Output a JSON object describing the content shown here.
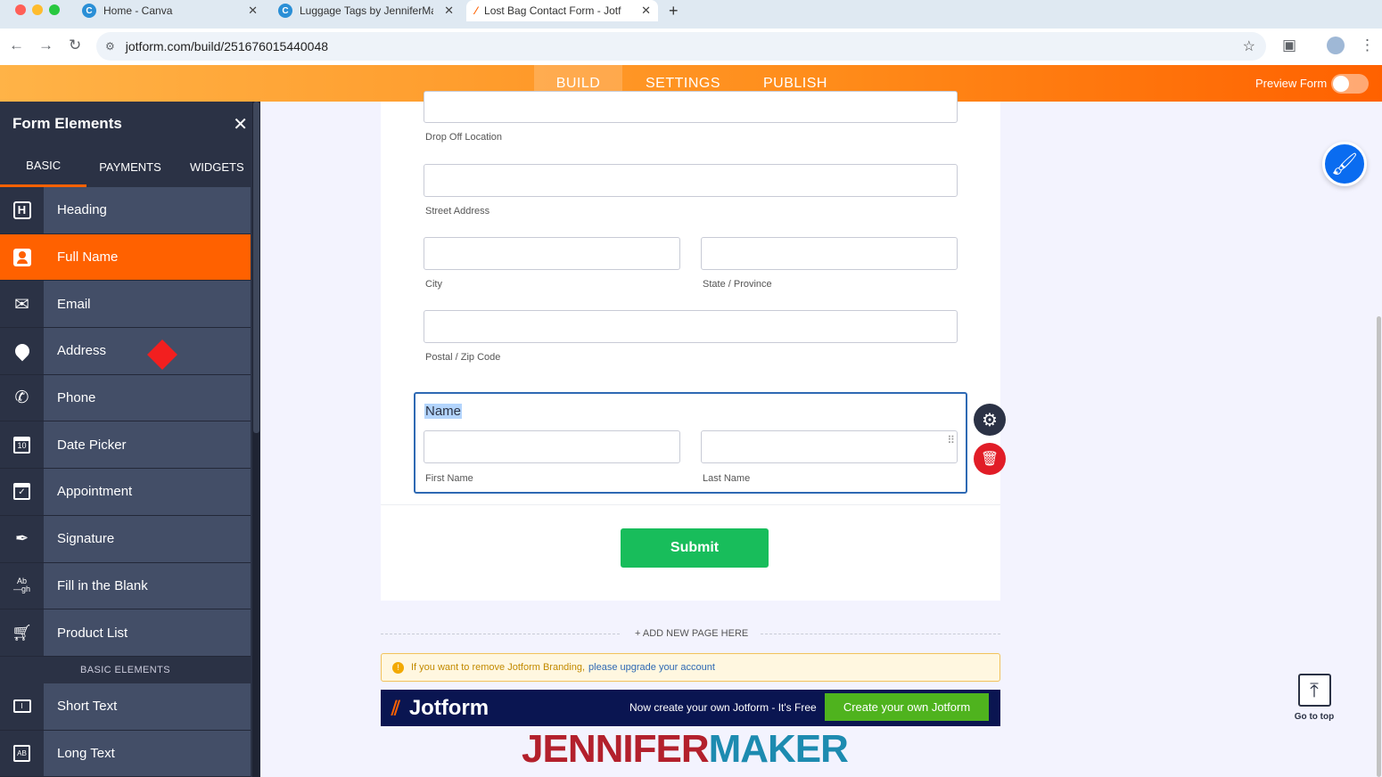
{
  "browser": {
    "tabs": [
      {
        "title": "Home - Canva",
        "icon": "canva-icon"
      },
      {
        "title": "Luggage Tags by JenniferMal",
        "icon": "canva-icon"
      },
      {
        "title": "Lost Bag Contact Form - Jotf",
        "icon": "jotform-icon"
      }
    ],
    "new_tab": "+",
    "url": "jotform.com/build/251676015440048"
  },
  "builder": {
    "nav": [
      "BUILD",
      "SETTINGS",
      "PUBLISH"
    ],
    "active_nav": "BUILD",
    "preview_label": "Preview Form"
  },
  "sidebar": {
    "title": "Form Elements",
    "tabs": [
      "BASIC",
      "PAYMENTS",
      "WIDGETS"
    ],
    "items": [
      {
        "label": "Heading",
        "icon": "heading-icon"
      },
      {
        "label": "Full Name",
        "icon": "person-icon"
      },
      {
        "label": "Email",
        "icon": "envelope-icon"
      },
      {
        "label": "Address",
        "icon": "map-pin-icon"
      },
      {
        "label": "Phone",
        "icon": "phone-icon"
      },
      {
        "label": "Date Picker",
        "icon": "calendar-icon"
      },
      {
        "label": "Appointment",
        "icon": "calendar-check-icon"
      },
      {
        "label": "Signature",
        "icon": "pen-icon"
      },
      {
        "label": "Fill in the Blank",
        "icon": "fill-blank-icon"
      },
      {
        "label": "Product List",
        "icon": "cart-icon"
      }
    ],
    "section_label": "BASIC ELEMENTS",
    "items2": [
      {
        "label": "Short Text",
        "icon": "short-text-icon"
      },
      {
        "label": "Long Text",
        "icon": "long-text-icon"
      }
    ]
  },
  "form": {
    "drop_off_label": "Drop Off Location",
    "street_label": "Street Address",
    "city_label": "City",
    "state_label": "State / Province",
    "zip_label": "Postal / Zip Code",
    "name_heading": "Name",
    "first_label": "First Name",
    "last_label": "Last Name",
    "submit": "Submit",
    "add_page": "+ ADD NEW PAGE HERE",
    "branding_warning": "If you want to remove Jotform Branding,",
    "branding_link": "please upgrade your account",
    "jotform_brand": "Jotform",
    "banner_text": "Now create your own Jotform - It's Free",
    "banner_button": "Create your own Jotform"
  },
  "watermark": {
    "part1": "JENNIFER",
    "part2": "MAKER"
  },
  "go_to_top": "Go to top",
  "colors": {
    "orange": "#ff6100",
    "sidebar": "#2b3245",
    "green": "#18bd5b",
    "blue": "#2e69b3"
  }
}
